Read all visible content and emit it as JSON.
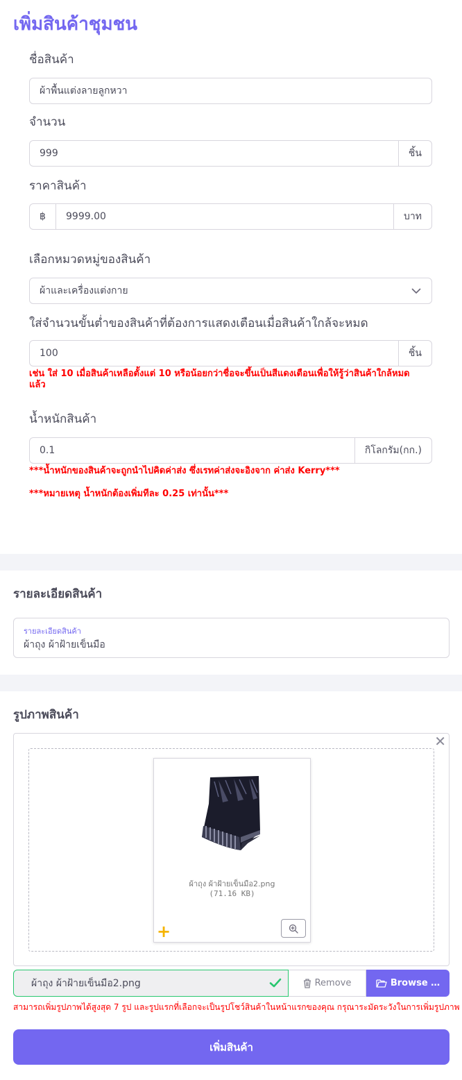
{
  "page_title": "เพิ่มสินค้าชุมชน",
  "product_name": {
    "label": "ชื่อสินค้า",
    "value": "ผ้าพื้นแต่งลายลูกหวา"
  },
  "quantity": {
    "label": "จำนวน",
    "value": "999",
    "unit": "ชิ้น"
  },
  "price": {
    "label": "ราคาสินค้า",
    "currency_symbol": "฿",
    "value": "9999.00",
    "unit": "บาท"
  },
  "category": {
    "label": "เลือกหมวดหมู่ของสินค้า",
    "selected": "ผ้าและเครื่องแต่งกาย"
  },
  "min_stock": {
    "label": "ใส่จำนวนขั้นต่ำของสินค้าที่ต้องการแสดงเตือนเมื่อสินค้าใกล้จะหมด",
    "value": "100",
    "unit": "ชิ้น",
    "hint_line1": "เช่น ใส่ 10 เมื่อสินค้าเหลือตั้งแต่ 10 หรือน้อยกว่าชื่อจะขึ้นเป็นสีแดงเตือนเพื่อให้รู้ว่าสินค้าใกล้หมด",
    "hint_line2": "แล้ว"
  },
  "weight": {
    "label": "น้ำหนักสินค้า",
    "value": "0.1",
    "unit": "กิโลกรัม(กก.)",
    "note1": "***น้ำหนักของสินค้าจะถูกนำไปคิดค่าส่ง ซึ่งเรทค่าส่งจะอิงจาก ค่าส่ง Kerry***",
    "note2": "***หมายเหตุ น้ำหนักต้องเพิ่มทีละ 0.25 เท่านั้น***"
  },
  "details": {
    "section_title": "รายละเอียดสินค้า",
    "field_label": "รายละเอียดสินค้า",
    "value": "ผ้าถุง ผ้าฝ้ายเข็นมือ"
  },
  "images": {
    "section_title": "รูปภาพสินค้า",
    "preview_filename": "ผ้าถุง ผ้าฝ้ายเข็นมือ2.png",
    "preview_size": "(71.16 KB)",
    "selected_file": "ผ้าถุง ผ้าฝ้ายเข็นมือ2.png",
    "remove_label": "Remove",
    "browse_label": "Browse …",
    "note": "สามารถเพิ่มรูปภาพได้สูงสุด 7 รูป และรูปแรกที่เลือกจะเป็นรูปโชว์สินค้าในหน้าแรกของคุณ กรุณาระมัดระวังในการเพิ่มรูปภาพ"
  },
  "submit_label": "เพิ่มสินค้า",
  "colors": {
    "accent": "#7367f0",
    "warning": "#ff0000",
    "success": "#28c76f",
    "plus": "#f5b400"
  }
}
